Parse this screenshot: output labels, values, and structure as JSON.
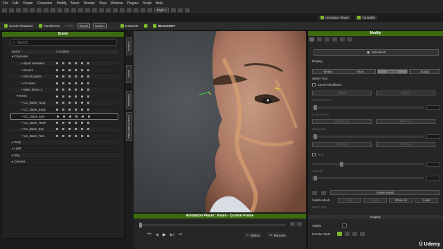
{
  "menu": [
    "File",
    "Edit",
    "Create",
    "Character",
    "Modify",
    "Mesh",
    "Render",
    "View",
    "Window",
    "Plugins",
    "Script",
    "Help"
  ],
  "toolbar": {
    "quality": "High",
    "anim_player_label": "Animation Player",
    "turntable_label": "Turntable"
  },
  "toolbar2": {
    "create_character": "Create Character",
    "transformer": "Transformer",
    "outfit": "Outfit",
    "morph": "Morph",
    "motion": "Motion",
    "iclone": "InstaLOD",
    "headshot": "HEADSHOT"
  },
  "scene": {
    "title": "Scene",
    "search_placeholder": "Search",
    "col_name": "Name",
    "col_condition": "Condition",
    "items": [
      {
        "label": "Character",
        "indent": 0,
        "icons": false,
        "arrow": "▾"
      },
      {
        "label": "Sport sneakers",
        "indent": 2,
        "icons": true
      },
      {
        "label": "Boxers",
        "indent": 2,
        "icons": true
      },
      {
        "label": "Slim fit pants",
        "indent": 2,
        "icons": true
      },
      {
        "label": "Fit shirts",
        "indent": 2,
        "icons": true
      },
      {
        "label": "Male_Brow_2",
        "indent": 2,
        "icons": true
      },
      {
        "label": "Kevin",
        "indent": 1,
        "icons": true,
        "arrow": "▾"
      },
      {
        "label": "CC_Base_Tong",
        "indent": 2,
        "icons": true
      },
      {
        "label": "CC_Base_Body",
        "indent": 2,
        "icons": true
      },
      {
        "label": "CC_Base_Eye",
        "indent": 2,
        "icons": true,
        "highlight": true
      },
      {
        "label": "CC_Base_Teeth",
        "indent": 2,
        "icons": true
      },
      {
        "label": "CC_Base_Eye",
        "indent": 2,
        "icons": true
      },
      {
        "label": "CC_Base_Tear",
        "indent": 2,
        "icons": true
      },
      {
        "label": "Prop",
        "indent": 0,
        "icons": false,
        "arrow": "▸"
      },
      {
        "label": "Light",
        "indent": 0,
        "icons": false,
        "arrow": "▸"
      },
      {
        "label": "Sky",
        "indent": 0,
        "icons": false,
        "arrow": "▸"
      },
      {
        "label": "Camera",
        "indent": 0,
        "icons": false,
        "arrow": "▸"
      }
    ]
  },
  "side_tabs": [
    "Content",
    "Scene",
    "Headshot",
    "Facial Profile Editor"
  ],
  "anim_player": {
    "title": "Animation Player : Kevin - Current Frame",
    "motion_label": "Motion",
    "remove_label": "Remove"
  },
  "modify": {
    "title": "Modify",
    "edit_mesh": "Edit Mesh",
    "display_label": "Display",
    "modes": [
      "Vertex",
      "Face",
      "Element",
      "Sculpt"
    ],
    "active_mode": "Element",
    "select_tool": "Select Tool",
    "ignore_backfaces": "Ignore Backfaces",
    "mirror": "Mirror",
    "grow": "Grow",
    "soft_selection": "Soft Selection",
    "loop_select": "Loop Select",
    "unhide_all": "Unhide All",
    "hide_face": "Hide Face",
    "show_face": "Show Face",
    "merge_by": "Merge By",
    "smooth": "Smooth",
    "expand": "Expand",
    "shrink": "Shrink",
    "ring": "Ring",
    "delete_mesh": "Delete Mesh",
    "visible_mesh": "Visible Mesh",
    "hide": "Hide",
    "show": "Show",
    "show_all": "Show All",
    "load": "Load",
    "mesh_ops": "Mesh Ops",
    "display_section": "Display",
    "visible_label": "Visible",
    "render_state": "Render State"
  },
  "watermark": "Udemy",
  "colors": {
    "accent": "#7cbc2c",
    "panel_title": "#3d6b10"
  }
}
